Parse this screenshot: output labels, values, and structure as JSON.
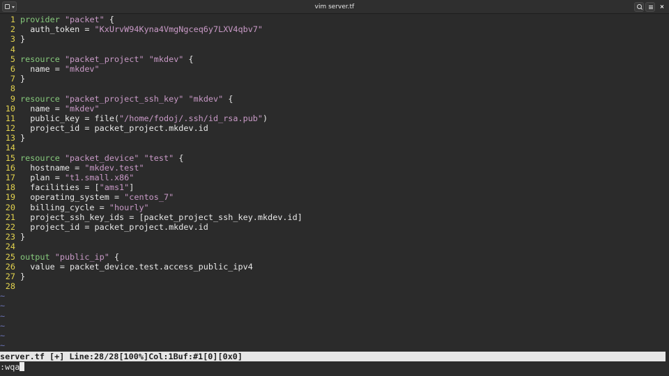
{
  "window": {
    "title": "vim server.tf",
    "menu_icon": "window-menu-icon",
    "search_icon": "search-icon",
    "hamburger_icon": "hamburger-menu-icon",
    "close_icon": "close-icon",
    "close_glyph": "×"
  },
  "editor": {
    "tilde": "~",
    "lines": [
      {
        "n": "1",
        "tokens": [
          {
            "t": "provider",
            "c": "kw"
          },
          {
            "t": " "
          },
          {
            "t": "\"packet\"",
            "c": "str"
          },
          {
            "t": " {"
          }
        ]
      },
      {
        "n": "2",
        "tokens": [
          {
            "t": "  auth_token = "
          },
          {
            "t": "\"KxUrvW94Kyna4VmgNgceq6y7LXV4qbv7\"",
            "c": "str"
          }
        ]
      },
      {
        "n": "3",
        "tokens": [
          {
            "t": "}"
          }
        ]
      },
      {
        "n": "4",
        "tokens": []
      },
      {
        "n": "5",
        "tokens": [
          {
            "t": "resource",
            "c": "kw"
          },
          {
            "t": " "
          },
          {
            "t": "\"packet_project\"",
            "c": "str"
          },
          {
            "t": " "
          },
          {
            "t": "\"mkdev\"",
            "c": "str"
          },
          {
            "t": " {"
          }
        ]
      },
      {
        "n": "6",
        "tokens": [
          {
            "t": "  name = "
          },
          {
            "t": "\"mkdev\"",
            "c": "str"
          }
        ]
      },
      {
        "n": "7",
        "tokens": [
          {
            "t": "}"
          }
        ]
      },
      {
        "n": "8",
        "tokens": []
      },
      {
        "n": "9",
        "tokens": [
          {
            "t": "resource",
            "c": "kw"
          },
          {
            "t": " "
          },
          {
            "t": "\"packet_project_ssh_key\"",
            "c": "str"
          },
          {
            "t": " "
          },
          {
            "t": "\"mkdev\"",
            "c": "str"
          },
          {
            "t": " {"
          }
        ]
      },
      {
        "n": "10",
        "tokens": [
          {
            "t": "  name = "
          },
          {
            "t": "\"mkdev\"",
            "c": "str"
          }
        ]
      },
      {
        "n": "11",
        "tokens": [
          {
            "t": "  public_key = file("
          },
          {
            "t": "\"/home/fodoj/.ssh/id_rsa.pub\"",
            "c": "str"
          },
          {
            "t": ")"
          }
        ]
      },
      {
        "n": "12",
        "tokens": [
          {
            "t": "  project_id = packet_project.mkdev.id"
          }
        ]
      },
      {
        "n": "13",
        "tokens": [
          {
            "t": "}"
          }
        ]
      },
      {
        "n": "14",
        "tokens": []
      },
      {
        "n": "15",
        "tokens": [
          {
            "t": "resource",
            "c": "kw"
          },
          {
            "t": " "
          },
          {
            "t": "\"packet_device\"",
            "c": "str"
          },
          {
            "t": " "
          },
          {
            "t": "\"test\"",
            "c": "str"
          },
          {
            "t": " {"
          }
        ]
      },
      {
        "n": "16",
        "tokens": [
          {
            "t": "  hostname = "
          },
          {
            "t": "\"mkdev.test\"",
            "c": "str"
          }
        ]
      },
      {
        "n": "17",
        "tokens": [
          {
            "t": "  plan = "
          },
          {
            "t": "\"t1.small.x86\"",
            "c": "str"
          }
        ]
      },
      {
        "n": "18",
        "tokens": [
          {
            "t": "  facilities = ["
          },
          {
            "t": "\"ams1\"",
            "c": "str"
          },
          {
            "t": "]"
          }
        ]
      },
      {
        "n": "19",
        "tokens": [
          {
            "t": "  operating_system = "
          },
          {
            "t": "\"centos_7\"",
            "c": "str"
          }
        ]
      },
      {
        "n": "20",
        "tokens": [
          {
            "t": "  billing_cycle = "
          },
          {
            "t": "\"hourly\"",
            "c": "str"
          }
        ]
      },
      {
        "n": "21",
        "tokens": [
          {
            "t": "  project_ssh_key_ids = [packet_project_ssh_key.mkdev.id]"
          }
        ]
      },
      {
        "n": "22",
        "tokens": [
          {
            "t": "  project_id = packet_project.mkdev.id"
          }
        ]
      },
      {
        "n": "23",
        "tokens": [
          {
            "t": "}"
          }
        ]
      },
      {
        "n": "24",
        "tokens": []
      },
      {
        "n": "25",
        "tokens": [
          {
            "t": "output",
            "c": "kw"
          },
          {
            "t": " "
          },
          {
            "t": "\"public_ip\"",
            "c": "str"
          },
          {
            "t": " {"
          }
        ]
      },
      {
        "n": "26",
        "tokens": [
          {
            "t": "  value = packet_device.test.access_public_ipv4"
          }
        ]
      },
      {
        "n": "27",
        "tokens": [
          {
            "t": "}"
          }
        ]
      },
      {
        "n": "28",
        "tokens": []
      }
    ],
    "empty_rows": 6
  },
  "statusline": {
    "text": "server.tf [+] Line:28/28[100%]Col:1Buf:#1[0][0x0]"
  },
  "commandline": {
    "text": ":wqa"
  },
  "colors": {
    "background": "#2b2b2b",
    "line_number": "#e3d34f",
    "keyword": "#86c97c",
    "string": "#c99ac7",
    "tilde": "#6b73b8",
    "statusline_bg": "#e6e6e6"
  }
}
